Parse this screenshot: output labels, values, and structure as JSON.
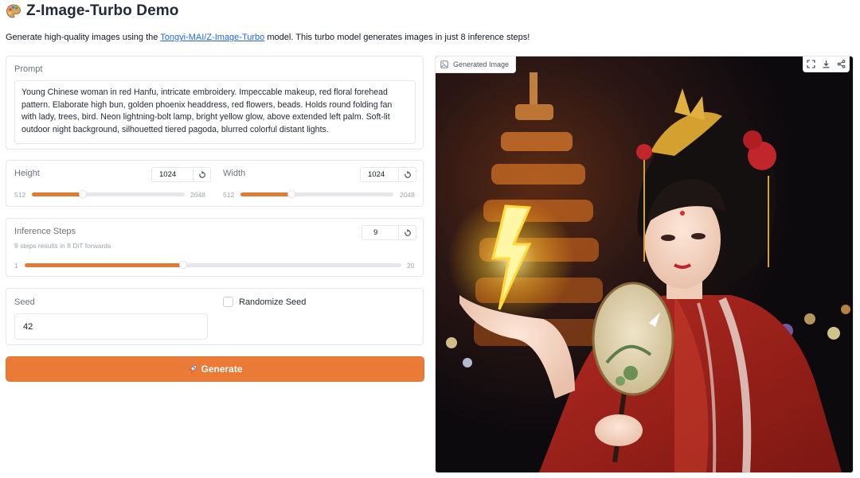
{
  "header": {
    "title": "Z-Image-Turbo Demo",
    "description_prefix": "Generate high-quality images using the ",
    "model_link": "Tongyi-MAI/Z-Image-Turbo",
    "description_suffix": " model. This turbo model generates images in just 8 inference steps!"
  },
  "prompt": {
    "label": "Prompt",
    "value": "Young Chinese woman in red Hanfu, intricate embroidery. Impeccable makeup, red floral forehead pattern. Elaborate high bun, golden phoenix headdress, red flowers, beads. Holds round folding fan with lady, trees, bird. Neon lightning-bolt lamp, bright yellow glow, above extended left palm. Soft-lit outdoor night background, silhouetted tiered pagoda, blurred colorful distant lights."
  },
  "height": {
    "label": "Height",
    "value": "1024",
    "min": "512",
    "max": "2048",
    "fill_fraction": 0.333
  },
  "width": {
    "label": "Width",
    "value": "1024",
    "min": "512",
    "max": "2048",
    "fill_fraction": 0.333
  },
  "steps": {
    "label": "Inference Steps",
    "info": "9 steps results in 8 DiT forwards",
    "value": "9",
    "min": "1",
    "max": "20",
    "fill_fraction": 0.421
  },
  "seed": {
    "label": "Seed",
    "value": "42",
    "randomize_label": "Randomize Seed",
    "randomize_checked": false
  },
  "generate": {
    "label": "Generate",
    "icon": "rocket-icon"
  },
  "output": {
    "label": "Generated Image",
    "tools": [
      "fullscreen-icon",
      "download-icon",
      "share-icon"
    ]
  },
  "colors": {
    "accent": "#ea7a35",
    "link": "#2563eb",
    "border": "#e5e7eb",
    "muted": "#6b7280"
  }
}
